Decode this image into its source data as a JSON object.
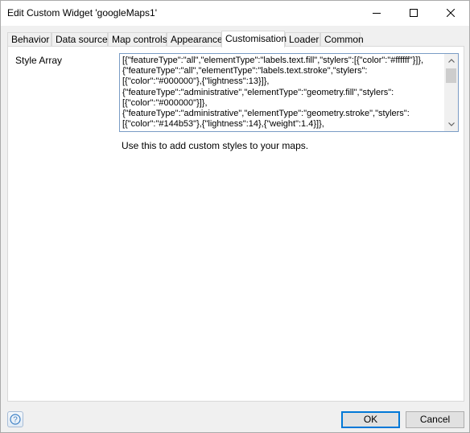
{
  "window": {
    "title": "Edit Custom Widget 'googleMaps1'"
  },
  "tabs": [
    {
      "label": "Behavior"
    },
    {
      "label": "Data source"
    },
    {
      "label": "Map controls"
    },
    {
      "label": "Appearance"
    },
    {
      "label": "Customisation"
    },
    {
      "label": "Loader"
    },
    {
      "label": "Common"
    }
  ],
  "active_tab": "Customisation",
  "style_array": {
    "label": "Style Array",
    "value": "[{\"featureType\":\"all\",\"elementType\":\"labels.text.fill\",\"stylers\":[{\"color\":\"#ffffff\"}]},\n{\"featureType\":\"all\",\"elementType\":\"labels.text.stroke\",\"stylers\":\n[{\"color\":\"#000000\"},{\"lightness\":13}]},\n{\"featureType\":\"administrative\",\"elementType\":\"geometry.fill\",\"stylers\":\n[{\"color\":\"#000000\"}]},\n{\"featureType\":\"administrative\",\"elementType\":\"geometry.stroke\",\"stylers\":\n[{\"color\":\"#144b53\"},{\"lightness\":14},{\"weight\":1.4}]},",
    "help": "Use this to add custom styles to your maps."
  },
  "buttons": {
    "ok": "OK",
    "cancel": "Cancel"
  },
  "icons": {
    "minimize": "minimize-icon",
    "maximize": "maximize-icon",
    "close": "close-icon",
    "help": "help-icon"
  }
}
